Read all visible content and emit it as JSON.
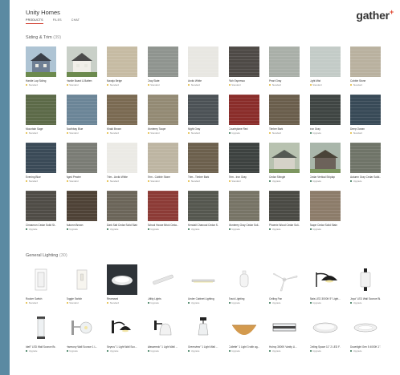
{
  "app": {
    "title": "Unity Homes",
    "tabs": [
      {
        "label": "PRODUCTS",
        "active": true
      },
      {
        "label": "FILES",
        "active": false
      },
      {
        "label": "CHAT",
        "active": false
      }
    ],
    "logo": "gather",
    "logo_mark": "+"
  },
  "colors": {
    "accent": "#d0392b",
    "standard_dot": "#e0b533",
    "upgrade_dot": "#2a6e4c"
  },
  "siding": {
    "title": "Siding & Trim",
    "count": "(39)",
    "items": [
      {
        "name": "Hardie Lap Siding",
        "tag": "Standard",
        "kind": "house",
        "color": "#aec4d4"
      },
      {
        "name": "Hardie Board & Batten",
        "tag": "Standard",
        "kind": "house2",
        "color": "#c9d0c8"
      },
      {
        "name": "Navajo Beige",
        "tag": "Standard",
        "kind": "swatch",
        "color": "#c6bba3"
      },
      {
        "name": "Gray Slate",
        "tag": "Standard",
        "kind": "swatch",
        "color": "#8f948f"
      },
      {
        "name": "Arctic White",
        "tag": "Standard",
        "kind": "swatch",
        "color": "#e8e7e2"
      },
      {
        "name": "Rich Espresso",
        "tag": "Standard",
        "kind": "swatch",
        "color": "#4e4a46"
      },
      {
        "name": "Pearl Gray",
        "tag": "Standard",
        "kind": "swatch",
        "color": "#a9afa8"
      },
      {
        "name": "Light Mist",
        "tag": "Standard",
        "kind": "swatch",
        "color": "#c3cbc7"
      },
      {
        "name": "Cobble Stone",
        "tag": "Standard",
        "kind": "swatch",
        "color": "#b9b19f"
      },
      {
        "name": "",
        "tag": "",
        "kind": "none",
        "color": "#ffffff"
      },
      {
        "name": "Mountain Sage",
        "tag": "Standard",
        "kind": "swatch",
        "color": "#5c6a48"
      },
      {
        "name": "Boothbay Blue",
        "tag": "Standard",
        "kind": "swatch",
        "color": "#6b8597"
      },
      {
        "name": "Khaki Brown",
        "tag": "Standard",
        "kind": "swatch",
        "color": "#7a6a52"
      },
      {
        "name": "Monterey Taupe",
        "tag": "Standard",
        "kind": "swatch",
        "color": "#938a74"
      },
      {
        "name": "Night Gray",
        "tag": "Standard",
        "kind": "swatch",
        "color": "#4c5256"
      },
      {
        "name": "Countrylane Red",
        "tag": "Upgrade",
        "kind": "swatch",
        "color": "#8a2d2a"
      },
      {
        "name": "Timber Bark",
        "tag": "Standard",
        "kind": "swatch",
        "color": "#6a5e4c"
      },
      {
        "name": "Iron Gray",
        "tag": "Upgrade",
        "kind": "swatch",
        "color": "#3f4543"
      },
      {
        "name": "Deep Ocean",
        "tag": "Standard",
        "kind": "swatch",
        "color": "#384a57"
      },
      {
        "name": "",
        "tag": "",
        "kind": "none",
        "color": "#ffffff"
      },
      {
        "name": "Evening Blue",
        "tag": "Standard",
        "kind": "swatch",
        "color": "#3a4a57"
      },
      {
        "name": "Aged Pewter",
        "tag": "Standard",
        "kind": "swatch",
        "color": "#7a7c75"
      },
      {
        "name": "Trim - Arctic White",
        "tag": "Standard",
        "kind": "swatch",
        "color": "#ebeae5"
      },
      {
        "name": "Trim - Cobble Stone",
        "tag": "Standard",
        "kind": "swatch",
        "color": "#bdb5a2"
      },
      {
        "name": "Trim - Timber Bark",
        "tag": "Standard",
        "kind": "swatch",
        "color": "#6c604d"
      },
      {
        "name": "Trim - Iron Gray",
        "tag": "Standard",
        "kind": "swatch",
        "color": "#3d4240"
      },
      {
        "name": "Cedar Shingle",
        "tag": "Upgrade",
        "kind": "bldg",
        "color": "#b8c2b0"
      },
      {
        "name": "Cedar Vertical Shiplap",
        "tag": "Upgrade",
        "kind": "bldg-dark",
        "color": "#a9b6aa"
      },
      {
        "name": "Autumn Gray Cedar Solid...",
        "tag": "Upgrade",
        "kind": "swatch",
        "color": "#6f7468"
      },
      {
        "name": "",
        "tag": "",
        "kind": "none",
        "color": "#ffffff"
      },
      {
        "name": "Cinnamon Cedar Solid St...",
        "tag": "Upgrade",
        "kind": "swatch",
        "color": "#4f4c46"
      },
      {
        "name": "Autumn Brown",
        "tag": "Upgrade",
        "kind": "swatch",
        "color": "#4e4236"
      },
      {
        "name": "Dark Salt Cedar Solid Stain",
        "tag": "Upgrade",
        "kind": "swatch",
        "color": "#6b6559"
      },
      {
        "name": "School House Brick Ceda...",
        "tag": "Upgrade",
        "kind": "swatch",
        "color": "#8c3b36"
      },
      {
        "name": "Kendall Charcoal Cedar S...",
        "tag": "Upgrade",
        "kind": "swatch",
        "color": "#55574f"
      },
      {
        "name": "Monterey Gray Cedar Soli...",
        "tag": "Upgrade",
        "kind": "swatch",
        "color": "#777466"
      },
      {
        "name": "Phoenix Wood Cedar Soli...",
        "tag": "Upgrade",
        "kind": "swatch",
        "color": "#4a4a44"
      },
      {
        "name": "Taupe Cedar Solid Stain",
        "tag": "Upgrade",
        "kind": "swatch",
        "color": "#8c7c6a"
      },
      {
        "name": "",
        "tag": "",
        "kind": "none",
        "color": "#ffffff"
      },
      {
        "name": "",
        "tag": "",
        "kind": "none",
        "color": "#ffffff"
      }
    ]
  },
  "lighting": {
    "title": "General Lighting",
    "count": "(30)",
    "items": [
      {
        "name": "Rocker Switch",
        "tag": "Standard",
        "icon": "rocker-switch-icon"
      },
      {
        "name": "Toggle Switch",
        "tag": "Standard",
        "icon": "toggle-switch-icon"
      },
      {
        "name": "Recessed",
        "tag": "Standard",
        "icon": "recessed-light-icon"
      },
      {
        "name": "Utility Lights",
        "tag": "Upgrade",
        "icon": "utility-light-icon"
      },
      {
        "name": "Under Cabinet Lighting",
        "tag": "Upgrade",
        "icon": "under-cabinet-light-icon"
      },
      {
        "name": "Track Lighting",
        "tag": "Upgrade",
        "icon": "track-light-icon"
      },
      {
        "name": "Ceiling Fan",
        "tag": "Upgrade",
        "icon": "ceiling-fan-icon"
      },
      {
        "name": "Blais LED 3000K 9\" Light...",
        "tag": "Upgrade",
        "icon": "barn-sconce-icon"
      },
      {
        "name": "Joya\" LED Wall Sconce Bi...",
        "tag": "Upgrade",
        "icon": "wall-sconce-icon"
      },
      {
        "name": "",
        "tag": "",
        "icon": ""
      },
      {
        "name": "Idell\" LED Wall Sconce Br...",
        "tag": "Upgrade",
        "icon": "glass-sconce-icon"
      },
      {
        "name": "Harmony Wall Sconce 1 L...",
        "tag": "Upgrade",
        "icon": "globe-sconce-icon"
      },
      {
        "name": "Seyrus\" 1 Light Wall Sco...",
        "tag": "Upgrade",
        "icon": "black-sconce-icon"
      },
      {
        "name": "Wassereck\" 1 Light Wall ...",
        "tag": "Upgrade",
        "icon": "bell-sconce-icon"
      },
      {
        "name": "Greenview\" 1 Light Wall ...",
        "tag": "Upgrade",
        "icon": "cylinder-sconce-icon"
      },
      {
        "name": "Collette\" 1 Light 3 with ag...",
        "tag": "Upgrade",
        "icon": "dome-light-icon"
      },
      {
        "name": "Holroy 3000K Vanity Ll...",
        "tag": "Upgrade",
        "icon": "vanity-light-icon"
      },
      {
        "name": "Ceiling Space 11\" 2 LED F...",
        "tag": "Upgrade",
        "icon": "flush-mount-icon"
      },
      {
        "name": "Downlight Gen 5 4000K 1\"...",
        "tag": "Upgrade",
        "icon": "downlight-icon"
      },
      {
        "name": "",
        "tag": "",
        "icon": ""
      }
    ]
  }
}
